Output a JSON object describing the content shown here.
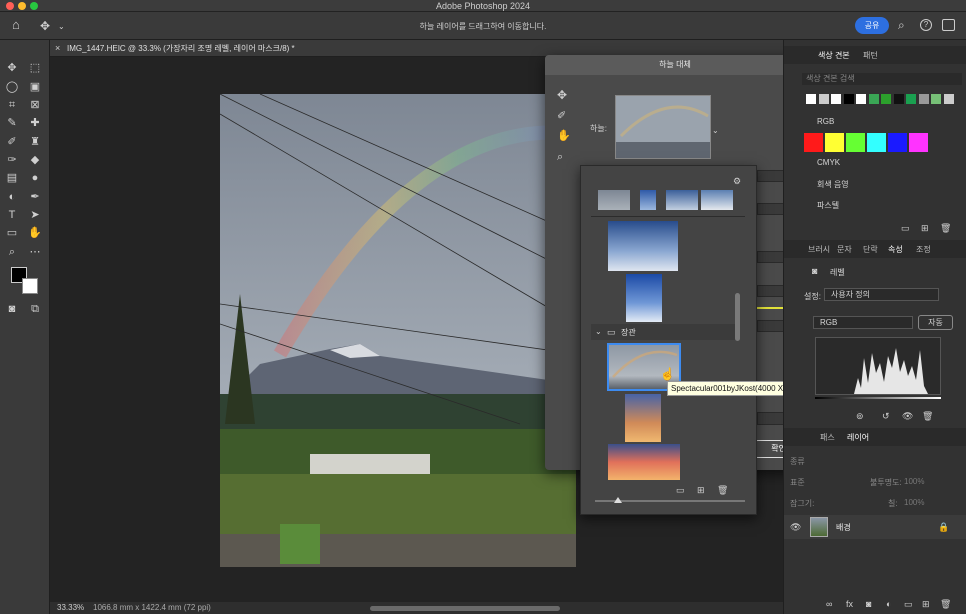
{
  "window": {
    "title": "Adobe Photoshop 2024"
  },
  "options_bar": {
    "hint": "하늘 레이어를 드래그하여 이동합니다.",
    "share_label": "공유"
  },
  "document": {
    "tab_title": "IMG_1447.HEIC @ 33.3% (가장자리 조명 레벨, 레이어 마스크/8) *",
    "zoom": "33.33%",
    "size_info": "1066.8 mm x 1422.4 mm (72 ppi)"
  },
  "sky_dialog": {
    "title": "하늘 대체",
    "sky_label": "하늘:",
    "folder_name": "장관",
    "tooltip": "Spectacular001byJKost(4000 X 2667픽셀)",
    "ok_label": "확인"
  },
  "swatches_panel": {
    "tabs": [
      "색상 견본",
      "패턴"
    ],
    "search_placeholder": "색상 견본 검색",
    "recent_colors": [
      "#ffffff",
      "#cccccc",
      "#ffffff",
      "#000000",
      "#ffffff",
      "#3aa655",
      "#2ca02c",
      "#111111",
      "#1aa050",
      "#999999",
      "#77c077",
      "#cccccc"
    ],
    "groups": [
      {
        "name": "RGB",
        "colors": [
          "#ff1a1a",
          "#ffff33",
          "#66ff33",
          "#33ffff",
          "#1a1aff",
          "#ff33ff"
        ]
      },
      {
        "name": "CMYK"
      },
      {
        "name": "회색 음영"
      },
      {
        "name": "파스텔"
      }
    ]
  },
  "properties_panel": {
    "tabs": [
      "브러시",
      "문자",
      "단락",
      "속성",
      "조정"
    ],
    "active_tab": "속성",
    "section": "레벨",
    "preset_label": "설정:",
    "preset_value": "사용자 정의",
    "channel": "RGB",
    "auto_label": "자동"
  },
  "layers_panel": {
    "tabs": [
      "패스",
      "레이어"
    ],
    "active_tab": "레이어",
    "kind_label": "종류",
    "blend_mode": "표준",
    "opacity_label": "불투명도:",
    "opacity": "100%",
    "lock_label": "잠그기:",
    "fill_label": "칠:",
    "fill": "100%",
    "layers": [
      {
        "name": "배경"
      }
    ]
  }
}
